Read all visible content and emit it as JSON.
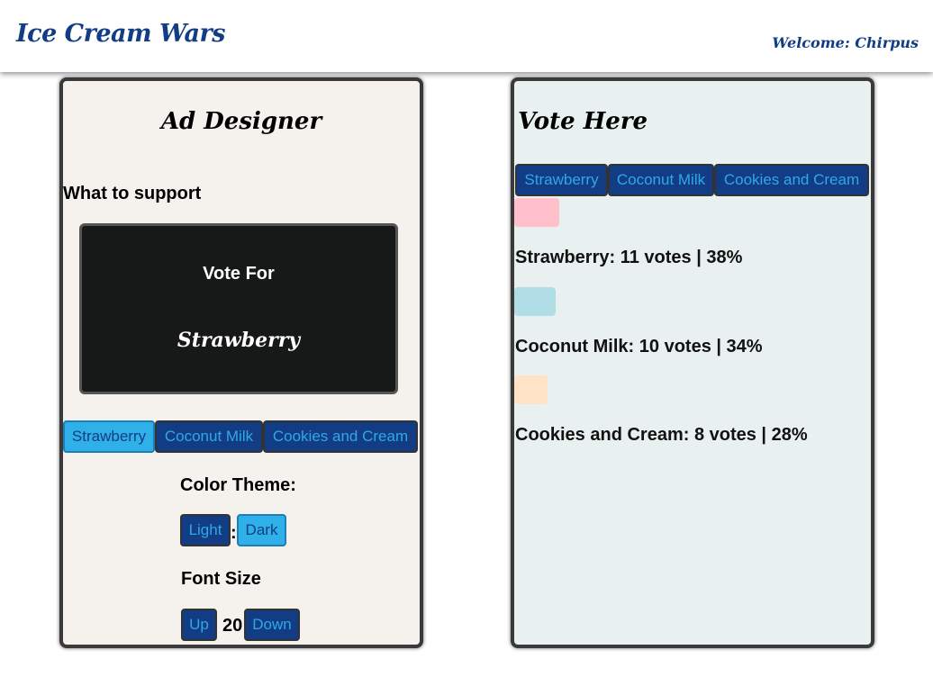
{
  "header": {
    "app_title": "Ice Cream Wars",
    "welcome": "Welcome: Chirpus"
  },
  "ad_designer": {
    "title": "Ad Designer",
    "support_label": "What to support",
    "preview": {
      "vote_for": "Vote For",
      "flavor": "Strawberry"
    },
    "flavor_buttons": [
      "Strawberry",
      "Coconut Milk",
      "Cookies and Cream"
    ],
    "selected_flavor": "Strawberry",
    "color_theme": {
      "label": "Color Theme:",
      "light": "Light",
      "separator": ":",
      "dark": "Dark",
      "selected": "Dark"
    },
    "font_size": {
      "label": "Font Size",
      "up": "Up",
      "value": "20",
      "down": "Down"
    }
  },
  "vote_panel": {
    "title": "Vote Here",
    "vote_buttons": [
      "Strawberry",
      "Coconut Milk",
      "Cookies and Cream"
    ],
    "results": [
      {
        "label": "Strawberry: 11 votes | 38%",
        "flavor": "Strawberry",
        "votes": 11,
        "percent": 38,
        "color": "#ffc0cb"
      },
      {
        "label": "Coconut Milk: 10 votes | 34%",
        "flavor": "Coconut Milk",
        "votes": 10,
        "percent": 34,
        "color": "#b0dde6"
      },
      {
        "label": "Cookies and Cream: 8 votes | 28%",
        "flavor": "Cookies and Cream",
        "votes": 8,
        "percent": 28,
        "color": "#ffe3c4"
      }
    ]
  },
  "colors": {
    "brand_blue": "#123d85",
    "button_text": "#2fa8e6",
    "active_button": "#2fb0e8",
    "left_panel_bg": "#f5f2ee",
    "right_panel_bg": "#e8f0f0",
    "preview_bg": "#171818"
  }
}
